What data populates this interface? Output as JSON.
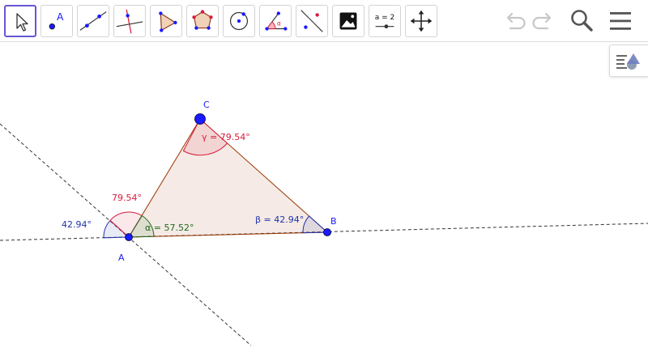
{
  "toolbar": {
    "tools": [
      {
        "id": "move",
        "icon": "arrow-pointer-icon"
      },
      {
        "id": "point",
        "icon": "point-icon",
        "label": "A"
      },
      {
        "id": "line",
        "icon": "line-through-points-icon"
      },
      {
        "id": "perpendicular",
        "icon": "perpendicular-line-icon"
      },
      {
        "id": "polygon",
        "icon": "polygon-icon"
      },
      {
        "id": "regular-polygon",
        "icon": "regular-polygon-icon"
      },
      {
        "id": "circle",
        "icon": "circle-center-point-icon"
      },
      {
        "id": "angle",
        "icon": "angle-icon",
        "label": "α"
      },
      {
        "id": "reflect",
        "icon": "reflect-about-line-icon"
      },
      {
        "id": "image",
        "icon": "image-icon"
      },
      {
        "id": "slider",
        "icon": "slider-icon",
        "label": "a = 2"
      },
      {
        "id": "move-view",
        "icon": "move-graphics-view-icon"
      }
    ],
    "right": [
      "undo-icon",
      "redo-icon",
      "search-icon",
      "menu-icon"
    ]
  },
  "style_bar_toggle": {
    "icon": "style-bar-icon"
  },
  "graphics": {
    "points": {
      "A": "A",
      "B": "B",
      "C": "C"
    },
    "angles": {
      "alpha": "α = 57.52°",
      "beta": "β = 42.94°",
      "gamma": "γ = 79.54°",
      "ext_gamma": "79.54°",
      "ext_beta": "42.94°"
    },
    "colors": {
      "point": "#1a1aff",
      "triangle_fill": "#f3e6e2",
      "triangle_edge": "#993300",
      "red": "#d81b3c",
      "green": "#1e6b1e",
      "blue": "#2233aa"
    }
  }
}
